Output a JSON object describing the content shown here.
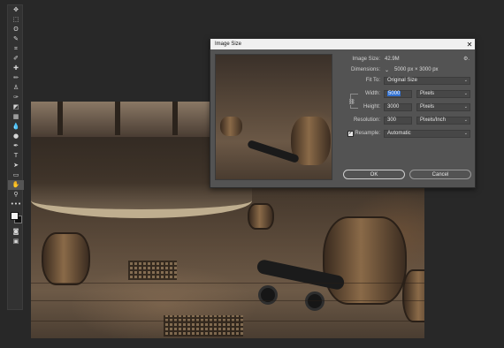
{
  "toolbar": {
    "tools": [
      {
        "name": "move-tool-icon",
        "glyph": "✥"
      },
      {
        "name": "marquee-tool-icon",
        "glyph": "⬚"
      },
      {
        "name": "lasso-tool-icon",
        "glyph": "ʘ"
      },
      {
        "name": "quick-select-tool-icon",
        "glyph": "✎"
      },
      {
        "name": "crop-tool-icon",
        "glyph": "⌗"
      },
      {
        "name": "eyedropper-tool-icon",
        "glyph": "✐"
      },
      {
        "name": "healing-brush-tool-icon",
        "glyph": "✚"
      },
      {
        "name": "brush-tool-icon",
        "glyph": "✏"
      },
      {
        "name": "clone-stamp-tool-icon",
        "glyph": "♙"
      },
      {
        "name": "history-brush-tool-icon",
        "glyph": "✑"
      },
      {
        "name": "eraser-tool-icon",
        "glyph": "◩"
      },
      {
        "name": "gradient-tool-icon",
        "glyph": "▦"
      },
      {
        "name": "blur-tool-icon",
        "glyph": "💧"
      },
      {
        "name": "dodge-tool-icon",
        "glyph": "●"
      },
      {
        "name": "pen-tool-icon",
        "glyph": "✒"
      },
      {
        "name": "type-tool-icon",
        "glyph": "T"
      },
      {
        "name": "path-select-tool-icon",
        "glyph": "➤"
      },
      {
        "name": "rectangle-tool-icon",
        "glyph": "▭"
      },
      {
        "name": "hand-tool-icon",
        "glyph": "✋",
        "active": true
      },
      {
        "name": "zoom-tool-icon",
        "glyph": "⚲"
      },
      {
        "name": "more-tools-icon",
        "glyph": "•••"
      }
    ],
    "bottom_tools": [
      {
        "name": "quick-mask-icon",
        "glyph": "◙"
      },
      {
        "name": "screen-mode-icon",
        "glyph": "▣"
      }
    ]
  },
  "dialog": {
    "title": "Image Size",
    "close_glyph": "✕",
    "gear_glyph": "⚙.",
    "image_size_label": "Image Size:",
    "image_size_value": "42.9M",
    "dimensions_label": "Dimensions:",
    "dimensions_value": "5000 px  ×  3000 px",
    "fit_to_label": "Fit To:",
    "fit_to_value": "Original Size",
    "width_label": "Width:",
    "width_value": "5000",
    "width_unit": "Pixels",
    "height_label": "Height:",
    "height_value": "3000",
    "height_unit": "Pixels",
    "resolution_label": "Resolution:",
    "resolution_value": "300",
    "resolution_unit": "Pixels/Inch",
    "resample_label": "Resample:",
    "resample_checked": true,
    "resample_value": "Automatic",
    "ok_label": "OK",
    "cancel_label": "Cancel"
  }
}
